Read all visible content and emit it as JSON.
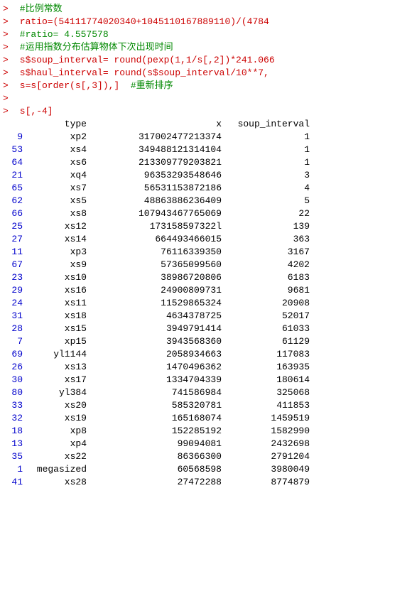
{
  "console": {
    "lines": [
      {
        "prompt": ">",
        "type": "comment",
        "text": " #比例常数"
      },
      {
        "prompt": ">",
        "type": "code",
        "text": " ratio=(54111774020340+1045110167889110)/(4784"
      },
      {
        "prompt": ">",
        "type": "comment",
        "text": " #ratio= 4.557578"
      },
      {
        "prompt": ">",
        "type": "comment",
        "text": " #运用指数分布估算物体下次出现时间"
      },
      {
        "prompt": ">",
        "type": "code",
        "text": " s$soup_interval= round(pexp(1,1/s[,2])*241.066"
      },
      {
        "prompt": ">",
        "type": "code",
        "text": " s$haul_interval= round(s$soup_interval/10**7,"
      },
      {
        "prompt": ">",
        "type": "code",
        "text": " s=s[order(s[,3]),]  #重新排序"
      },
      {
        "prompt": ">",
        "type": "empty",
        "text": ""
      },
      {
        "prompt": ">",
        "type": "code",
        "text": " s[,-4]"
      }
    ],
    "table": {
      "headers": [
        "type",
        "x",
        "soup_interval"
      ],
      "rows": [
        {
          "num": "9",
          "type": "xp2",
          "x": "317002477213374",
          "soup": "1"
        },
        {
          "num": "53",
          "type": "xs4",
          "x": "349488121314104",
          "soup": "1"
        },
        {
          "num": "64",
          "type": "xs6",
          "x": "213309779203821",
          "soup": "1"
        },
        {
          "num": "21",
          "type": "xq4",
          "x": "96353293548646",
          "soup": "3"
        },
        {
          "num": "65",
          "type": "xs7",
          "x": "56531153872186",
          "soup": "4"
        },
        {
          "num": "62",
          "type": "xs5",
          "x": "48863886236409",
          "soup": "5"
        },
        {
          "num": "66",
          "type": "xs8",
          "x": "107943467765069",
          "soup": "22"
        },
        {
          "num": "25",
          "type": "xs12",
          "x": "173158597322l",
          "soup": "139"
        },
        {
          "num": "27",
          "type": "xs14",
          "x": "664493466015",
          "soup": "363"
        },
        {
          "num": "11",
          "type": "xp3",
          "x": "76116339350",
          "soup": "3167"
        },
        {
          "num": "67",
          "type": "xs9",
          "x": "57365099560",
          "soup": "4202"
        },
        {
          "num": "23",
          "type": "xs10",
          "x": "38986720806",
          "soup": "6183"
        },
        {
          "num": "29",
          "type": "xs16",
          "x": "24900809731",
          "soup": "9681"
        },
        {
          "num": "24",
          "type": "xs11",
          "x": "11529865324",
          "soup": "20908"
        },
        {
          "num": "31",
          "type": "xs18",
          "x": "4634378725",
          "soup": "52017"
        },
        {
          "num": "28",
          "type": "xs15",
          "x": "3949791414",
          "soup": "61033"
        },
        {
          "num": "7",
          "type": "xp15",
          "x": "3943568360",
          "soup": "61129"
        },
        {
          "num": "69",
          "type": "yl1144",
          "x": "2058934663",
          "soup": "117083"
        },
        {
          "num": "26",
          "type": "xs13",
          "x": "1470496362",
          "soup": "163935"
        },
        {
          "num": "30",
          "type": "xs17",
          "x": "1334704339",
          "soup": "180614"
        },
        {
          "num": "80",
          "type": "yl384",
          "x": "741586984",
          "soup": "325068"
        },
        {
          "num": "33",
          "type": "xs20",
          "x": "585320781",
          "soup": "411853"
        },
        {
          "num": "32",
          "type": "xs19",
          "x": "165168074",
          "soup": "1459519"
        },
        {
          "num": "18",
          "type": "xp8",
          "x": "152285192",
          "soup": "1582990"
        },
        {
          "num": "13",
          "type": "xp4",
          "x": "99094081",
          "soup": "2432698"
        },
        {
          "num": "35",
          "type": "xs22",
          "x": "86366300",
          "soup": "2791204"
        },
        {
          "num": "1",
          "type": "megasized",
          "x": "60568598",
          "soup": "3980049"
        },
        {
          "num": "41",
          "type": "xs28",
          "x": "27472288",
          "soup": "8774879"
        }
      ]
    }
  }
}
